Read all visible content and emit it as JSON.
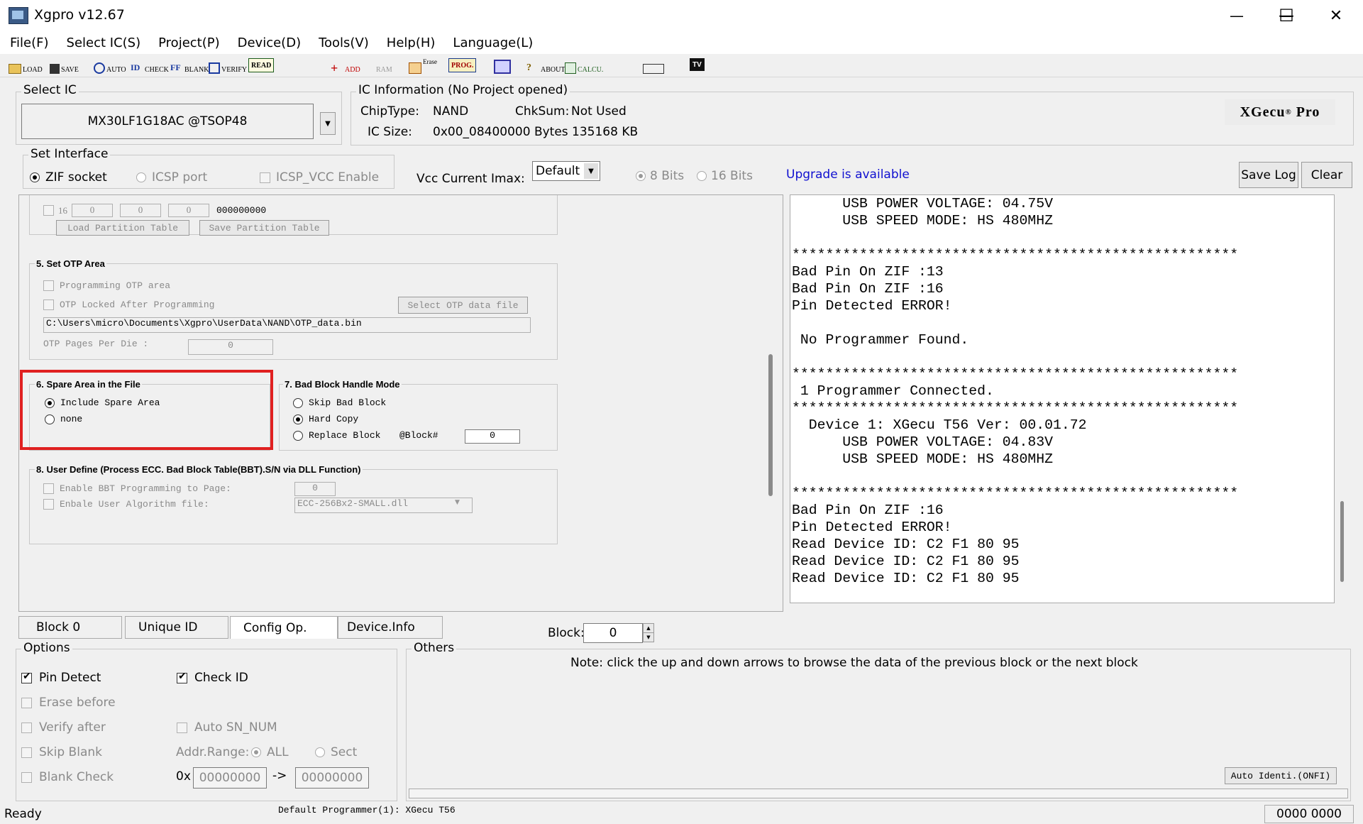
{
  "window": {
    "title": "Xgpro v12.67",
    "minimize": "—",
    "maximize": "☐",
    "close": "✕"
  },
  "menu": [
    "File(F)",
    "Select IC(S)",
    "Project(P)",
    "Device(D)",
    "Tools(V)",
    "Help(H)",
    "Language(L)"
  ],
  "toolbar": {
    "load": "LOAD",
    "save": "SAVE",
    "auto": "AUTO",
    "check": "CHECK",
    "blank": "BLANK",
    "verify": "VERIFY",
    "read": "READ",
    "add": "ADD",
    "ram": "RAM",
    "erase": "Erase",
    "prog": "PROG.",
    "about": "ABOUT",
    "calcu": "CALCU.",
    "tv": "TV"
  },
  "select_ic": {
    "title": "Select IC",
    "value": "MX30LF1G18AC @TSOP48"
  },
  "ic_info": {
    "title": "IC Information (No Project opened)",
    "chiptype_label": "ChipType:",
    "chiptype_value": "NAND",
    "chksum_label": "ChkSum:",
    "chksum_value": "Not Used",
    "icsize_label": "IC Size:",
    "icsize_value": "0x00_08400000 Bytes 135168 KB",
    "brand": "XGecu",
    "brand_suffix": "Pro"
  },
  "interface": {
    "title": "Set Interface",
    "zif": "ZIF socket",
    "icsp": "ICSP port",
    "icsp_vcc": "ICSP_VCC Enable",
    "vcc_label": "Vcc Current Imax:",
    "vcc_value": "Default",
    "bits8": "8 Bits",
    "bits16": "16 Bits",
    "upgrade": "Upgrade is available",
    "save_log": "Save Log",
    "clear": "Clear"
  },
  "config": {
    "partition": {
      "num": "16",
      "v1": "0",
      "v2": "0",
      "v3": "0",
      "hex": "000000000",
      "load": "Load Partition Table",
      "save": "Save Partition Table"
    },
    "otp": {
      "title": "5. Set OTP Area",
      "programming": "Programming  OTP area",
      "locked": "OTP Locked After Programming",
      "select": "Select OTP data file",
      "path": "C:\\Users\\micro\\Documents\\Xgpro\\UserData\\NAND\\OTP_data.bin",
      "pages_label": "OTP Pages Per Die :",
      "pages_value": "0"
    },
    "spare": {
      "title": "6. Spare Area in the File",
      "include": "Include Spare Area",
      "none": "none"
    },
    "badblock": {
      "title": "7. Bad Block Handle Mode",
      "skip": "Skip Bad Block",
      "hard": "Hard Copy",
      "replace": "Replace Block",
      "block_label": "@Block#",
      "block_value": "0"
    },
    "user": {
      "title": "8. User Define (Process ECC. Bad Block Table(BBT).S/N via DLL Function)",
      "bbt": "Enable BBT Programming to Page:",
      "bbt_value": "0",
      "algo": "Enbale User Algorithm file:",
      "algo_value": "ECC-256Bx2-SMALL.dll"
    }
  },
  "log_lines": [
    "      USB POWER VOLTAGE: 04.75V",
    "      USB SPEED MODE: HS 480MHZ",
    "",
    "*****************************************************",
    "Bad Pin On ZIF :13",
    "Bad Pin On ZIF :16",
    "Pin Detected ERROR!",
    "",
    " No Programmer Found.",
    "",
    "*****************************************************",
    " 1 Programmer Connected.",
    "*****************************************************",
    "  Device 1: XGecu T56 Ver: 00.01.72",
    "      USB POWER VOLTAGE: 04.83V",
    "      USB SPEED MODE: HS 480MHZ",
    "",
    "*****************************************************",
    "Bad Pin On ZIF :16",
    "Pin Detected ERROR!",
    "Read Device ID: C2 F1 80 95",
    "Read Device ID: C2 F1 80 95",
    "Read Device ID: C2 F1 80 95"
  ],
  "tabs": [
    "Block 0",
    "Unique ID",
    "Config Op.",
    "Device.Info"
  ],
  "block": {
    "label": "Block:",
    "value": "0"
  },
  "options": {
    "title": "Options",
    "pin_detect": "Pin Detect",
    "check_id": "Check ID",
    "erase_before": "Erase before",
    "verify_after": "Verify after",
    "auto_sn": "Auto SN_NUM",
    "skip_blank": "Skip Blank",
    "addr_range": "Addr.Range:",
    "all": "ALL",
    "sect": "Sect",
    "blank_check": "Blank Check",
    "prefix": "0x",
    "from": "00000000",
    "arrow": "->",
    "to": "00000000"
  },
  "others": {
    "title": "Others",
    "note": "Note: click the up and down arrows to browse the data of the previous block or the next block",
    "auto_identi": "Auto Identi.(ONFI)"
  },
  "status": {
    "ready": "Ready",
    "programmer": "Default Programmer(1): XGecu T56",
    "counter": "0000 0000"
  }
}
